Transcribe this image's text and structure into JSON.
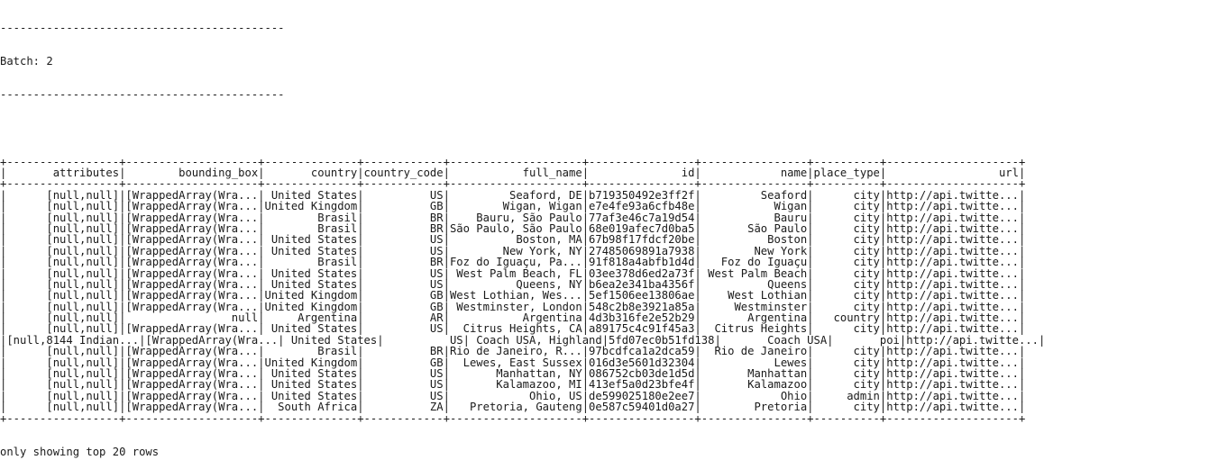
{
  "batch": {
    "separator": "-------------------------------------------",
    "label": "Batch: 2"
  },
  "table": {
    "columns": [
      {
        "name": "attributes",
        "width": 17
      },
      {
        "name": "bounding_box",
        "width": 20
      },
      {
        "name": "country",
        "width": 14
      },
      {
        "name": "country_code",
        "width": 12
      },
      {
        "name": "full_name",
        "width": 20
      },
      {
        "name": "id",
        "width": 16
      },
      {
        "name": "name",
        "width": 16
      },
      {
        "name": "place_type",
        "width": 10
      },
      {
        "name": "url",
        "width": 20
      }
    ],
    "rows": [
      [
        "[null,null]",
        "[WrappedArray(Wra...",
        "United States",
        "US",
        "Seaford, DE",
        "b719350492e3ff2f",
        "Seaford",
        "city",
        "http://api.twitte..."
      ],
      [
        "[null,null]",
        "[WrappedArray(Wra...",
        "United Kingdom",
        "GB",
        "Wigan, Wigan",
        "e7e4fe93a6cfb48e",
        "Wigan",
        "city",
        "http://api.twitte..."
      ],
      [
        "[null,null]",
        "[WrappedArray(Wra...",
        "Brasil",
        "BR",
        "Bauru, São Paulo",
        "77af3e46c7a19d54",
        "Bauru",
        "city",
        "http://api.twitte..."
      ],
      [
        "[null,null]",
        "[WrappedArray(Wra...",
        "Brasil",
        "BR",
        "São Paulo, São Paulo",
        "68e019afec7d0ba5",
        "São Paulo",
        "city",
        "http://api.twitte..."
      ],
      [
        "[null,null]",
        "[WrappedArray(Wra...",
        "United States",
        "US",
        "Boston, MA",
        "67b98f17fdcf20be",
        "Boston",
        "city",
        "http://api.twitte..."
      ],
      [
        "[null,null]",
        "[WrappedArray(Wra...",
        "United States",
        "US",
        "New York, NY",
        "27485069891a7938",
        "New York",
        "city",
        "http://api.twitte..."
      ],
      [
        "[null,null]",
        "[WrappedArray(Wra...",
        "Brasil",
        "BR",
        "Foz do Iguaçu, Pa...",
        "91f818a4abfb1d4d",
        "Foz do Iguaçu",
        "city",
        "http://api.twitte..."
      ],
      [
        "[null,null]",
        "[WrappedArray(Wra...",
        "United States",
        "US",
        "West Palm Beach, FL",
        "03ee378d6ed2a73f",
        "West Palm Beach",
        "city",
        "http://api.twitte..."
      ],
      [
        "[null,null]",
        "[WrappedArray(Wra...",
        "United States",
        "US",
        "Queens, NY",
        "b6ea2e341ba4356f",
        "Queens",
        "city",
        "http://api.twitte..."
      ],
      [
        "[null,null]",
        "[WrappedArray(Wra...",
        "United Kingdom",
        "GB",
        "West Lothian, Wes...",
        "5ef1506ee13806ae",
        "West Lothian",
        "city",
        "http://api.twitte..."
      ],
      [
        "[null,null]",
        "[WrappedArray(Wra...",
        "United Kingdom",
        "GB",
        "Westminster, London",
        "548c2b8e3921a85a",
        "Westminster",
        "city",
        "http://api.twitte..."
      ],
      [
        "[null,null]",
        "null",
        "Argentina",
        "AR",
        "Argentina",
        "4d3b316fe2e52b29",
        "Argentina",
        "country",
        "http://api.twitte..."
      ],
      [
        "[null,null]",
        "[WrappedArray(Wra...",
        "United States",
        "US",
        "Citrus Heights, CA",
        "a89175c4c91f45a3",
        "Citrus Heights",
        "city",
        "http://api.twitte..."
      ],
      [
        "[null,8144 Indian...",
        "[WrappedArray(Wra...",
        "United States",
        "US",
        "Coach USA, Highland",
        "5fd07ec0b51fd138",
        "Coach USA",
        "poi",
        "http://api.twitte..."
      ],
      [
        "[null,null]",
        "[WrappedArray(Wra...",
        "Brasil",
        "BR",
        "Rio de Janeiro, R...",
        "97bcdfca1a2dca59",
        "Rio de Janeiro",
        "city",
        "http://api.twitte..."
      ],
      [
        "[null,null]",
        "[WrappedArray(Wra...",
        "United Kingdom",
        "GB",
        "Lewes, East Sussex",
        "016d3e5601d32304",
        "Lewes",
        "city",
        "http://api.twitte..."
      ],
      [
        "[null,null]",
        "[WrappedArray(Wra...",
        "United States",
        "US",
        "Manhattan, NY",
        "086752cb03de1d5d",
        "Manhattan",
        "city",
        "http://api.twitte..."
      ],
      [
        "[null,null]",
        "[WrappedArray(Wra...",
        "United States",
        "US",
        "Kalamazoo, MI",
        "413ef5a0d23bfe4f",
        "Kalamazoo",
        "city",
        "http://api.twitte..."
      ],
      [
        "[null,null]",
        "[WrappedArray(Wra...",
        "United States",
        "US",
        "Ohio, US",
        "de599025180e2ee7",
        "Ohio",
        "admin",
        "http://api.twitte..."
      ],
      [
        "[null,null]",
        "[WrappedArray(Wra...",
        "South Africa",
        "ZA",
        "Pretoria, Gauteng",
        "0e587c59401d0a27",
        "Pretoria",
        "city",
        "http://api.twitte..."
      ]
    ],
    "row_groups": [
      1,
      2,
      1,
      2,
      1,
      2,
      1,
      2,
      2,
      1,
      2,
      1,
      2
    ],
    "footer": "only showing top 20 rows"
  }
}
